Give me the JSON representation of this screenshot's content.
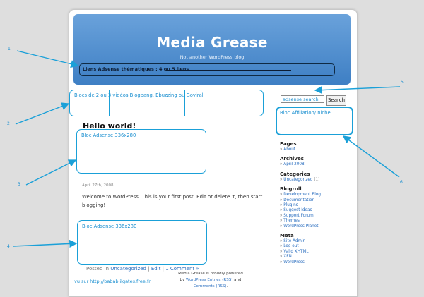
{
  "site": {
    "title": "Media Grease",
    "tagline": "Not another WordPress blog"
  },
  "header_ad": {
    "label": "Liens Adsense thématiques : 4 ou 5 liens"
  },
  "video_bar": {
    "label": "Blocs de 2 ou 3 vidéos Blogbang, Ebuzzing ou Goviral"
  },
  "post": {
    "title": "Hello world!",
    "ad_top": "Bloc Adsense 336x280",
    "date": "April 27th, 2008",
    "body": "Welcome to WordPress. This is your first post. Edit or delete it, then start blogging!",
    "ad_bottom": "Bloc Adsense 336x280",
    "meta_prefix": "Posted in",
    "category": "Uncategorized",
    "sep1": "|",
    "edit": "Edit",
    "sep2": "|",
    "comments": "1 Comment »"
  },
  "search": {
    "value": "adsense search",
    "button": "Search"
  },
  "affiliation": {
    "label": "Bloc Affiliation/ niche"
  },
  "sidebar": {
    "pages": {
      "heading": "Pages",
      "items": [
        "About"
      ]
    },
    "archives": {
      "heading": "Archives",
      "items": [
        "April 2008"
      ]
    },
    "categories": {
      "heading": "Categories",
      "item": "Uncategorized",
      "count": "(1)"
    },
    "blogroll": {
      "heading": "Blogroll",
      "items": [
        "Development Blog",
        "Documentation",
        "Plugins",
        "Suggest Ideas",
        "Support Forum",
        "Themes",
        "WordPress Planet"
      ]
    },
    "meta": {
      "heading": "Meta",
      "items": [
        "Site Admin",
        "Log out",
        "Valid XHTML",
        "XFN",
        "WordPress"
      ]
    }
  },
  "footer": {
    "line1": "Media Grease is proudly powered by",
    "wp": "WordPress",
    "entries": "Entries (RSS)",
    "and": "and",
    "comments": "Comments (RSS)",
    "note": "vu sur http://babablilgates.free.fr"
  },
  "callouts": [
    "1",
    "2",
    "3",
    "4",
    "5",
    "6"
  ],
  "colors": {
    "annotation": "#1aa0d8",
    "header_top": "#6aa2db",
    "header_bottom": "#3e7fc4"
  }
}
